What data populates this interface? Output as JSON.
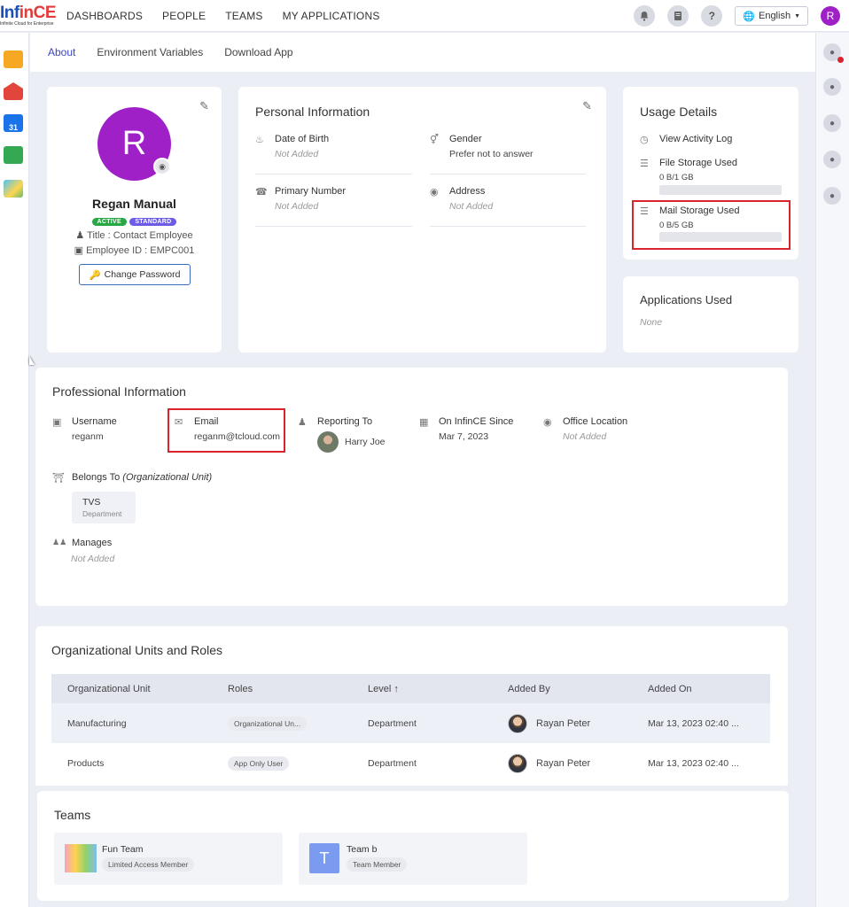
{
  "brand": {
    "name_blue": "Inf",
    "name_red": "inCE",
    "tagline": "Infinite Cloud for Enterprise"
  },
  "nav": {
    "items": [
      "DASHBOARDS",
      "PEOPLE",
      "TEAMS",
      "MY APPLICATIONS"
    ]
  },
  "topbar": {
    "language": "English",
    "avatar_letter": "R",
    "help": "?"
  },
  "tabs": [
    {
      "label": "About",
      "active": true
    },
    {
      "label": "Environment Variables",
      "active": false
    },
    {
      "label": "Download App",
      "active": false
    }
  ],
  "profile": {
    "avatar_letter": "R",
    "name": "Regan Manual",
    "badge_active": "ACTIVE",
    "badge_standard": "STANDARD",
    "title": "Title : Contact Employee",
    "employee_id": "Employee ID : EMPC001",
    "change_password": "Change Password"
  },
  "personal": {
    "title": "Personal Information",
    "dob_label": "Date of Birth",
    "dob_value": "Not Added",
    "gender_label": "Gender",
    "gender_value": "Prefer not to answer",
    "phone_label": "Primary Number",
    "phone_value": "Not Added",
    "address_label": "Address",
    "address_value": "Not Added"
  },
  "usage": {
    "title": "Usage Details",
    "activity_log": "View Activity Log",
    "file_label": "File Storage Used",
    "file_value": "0 B/1 GB",
    "file_fraction": 0,
    "mail_label": "Mail Storage Used",
    "mail_value": "0 B/5 GB",
    "mail_fraction": 0
  },
  "apps_used": {
    "title": "Applications Used",
    "value": "None"
  },
  "professional": {
    "title": "Professional Information",
    "username_label": "Username",
    "username_value": "reganm",
    "email_label": "Email",
    "email_value": "reganm@tcloud.com",
    "reporting_label": "Reporting To",
    "reporting_value": "Harry Joe",
    "since_label": "On InfinCE Since",
    "since_value": "Mar 7, 2023",
    "office_label": "Office Location",
    "office_value": "Not Added",
    "belongs_label": "Belongs To",
    "belongs_label_italic": "(Organizational Unit)",
    "unit_name": "TVS",
    "unit_type": "Department",
    "manages_label": "Manages",
    "manages_value": "Not Added"
  },
  "org_units": {
    "title": "Organizational Units and Roles",
    "columns": [
      "Organizational Unit",
      "Roles",
      "Level ↑",
      "Added By",
      "Added On"
    ],
    "rows": [
      {
        "unit": "Manufacturing",
        "role": "Organizational Un...",
        "level": "Department",
        "added_by": "Rayan Peter",
        "added_on": "Mar 13, 2023 02:40 ..."
      },
      {
        "unit": "Products",
        "role": "App Only User",
        "level": "Department",
        "added_by": "Rayan Peter",
        "added_on": "Mar 13, 2023 02:40 ..."
      }
    ]
  },
  "teams": {
    "title": "Teams",
    "items": [
      {
        "name": "Fun Team",
        "role": "Limited Access Member"
      },
      {
        "name": "Team b",
        "role": "Team Member",
        "letter": "T"
      }
    ]
  },
  "colors": {
    "primary": "#3b47c4",
    "avatar": "#a020c8",
    "active_badge": "#28a745",
    "standard_badge": "#6c5ce7",
    "highlight": "#d9232d"
  }
}
